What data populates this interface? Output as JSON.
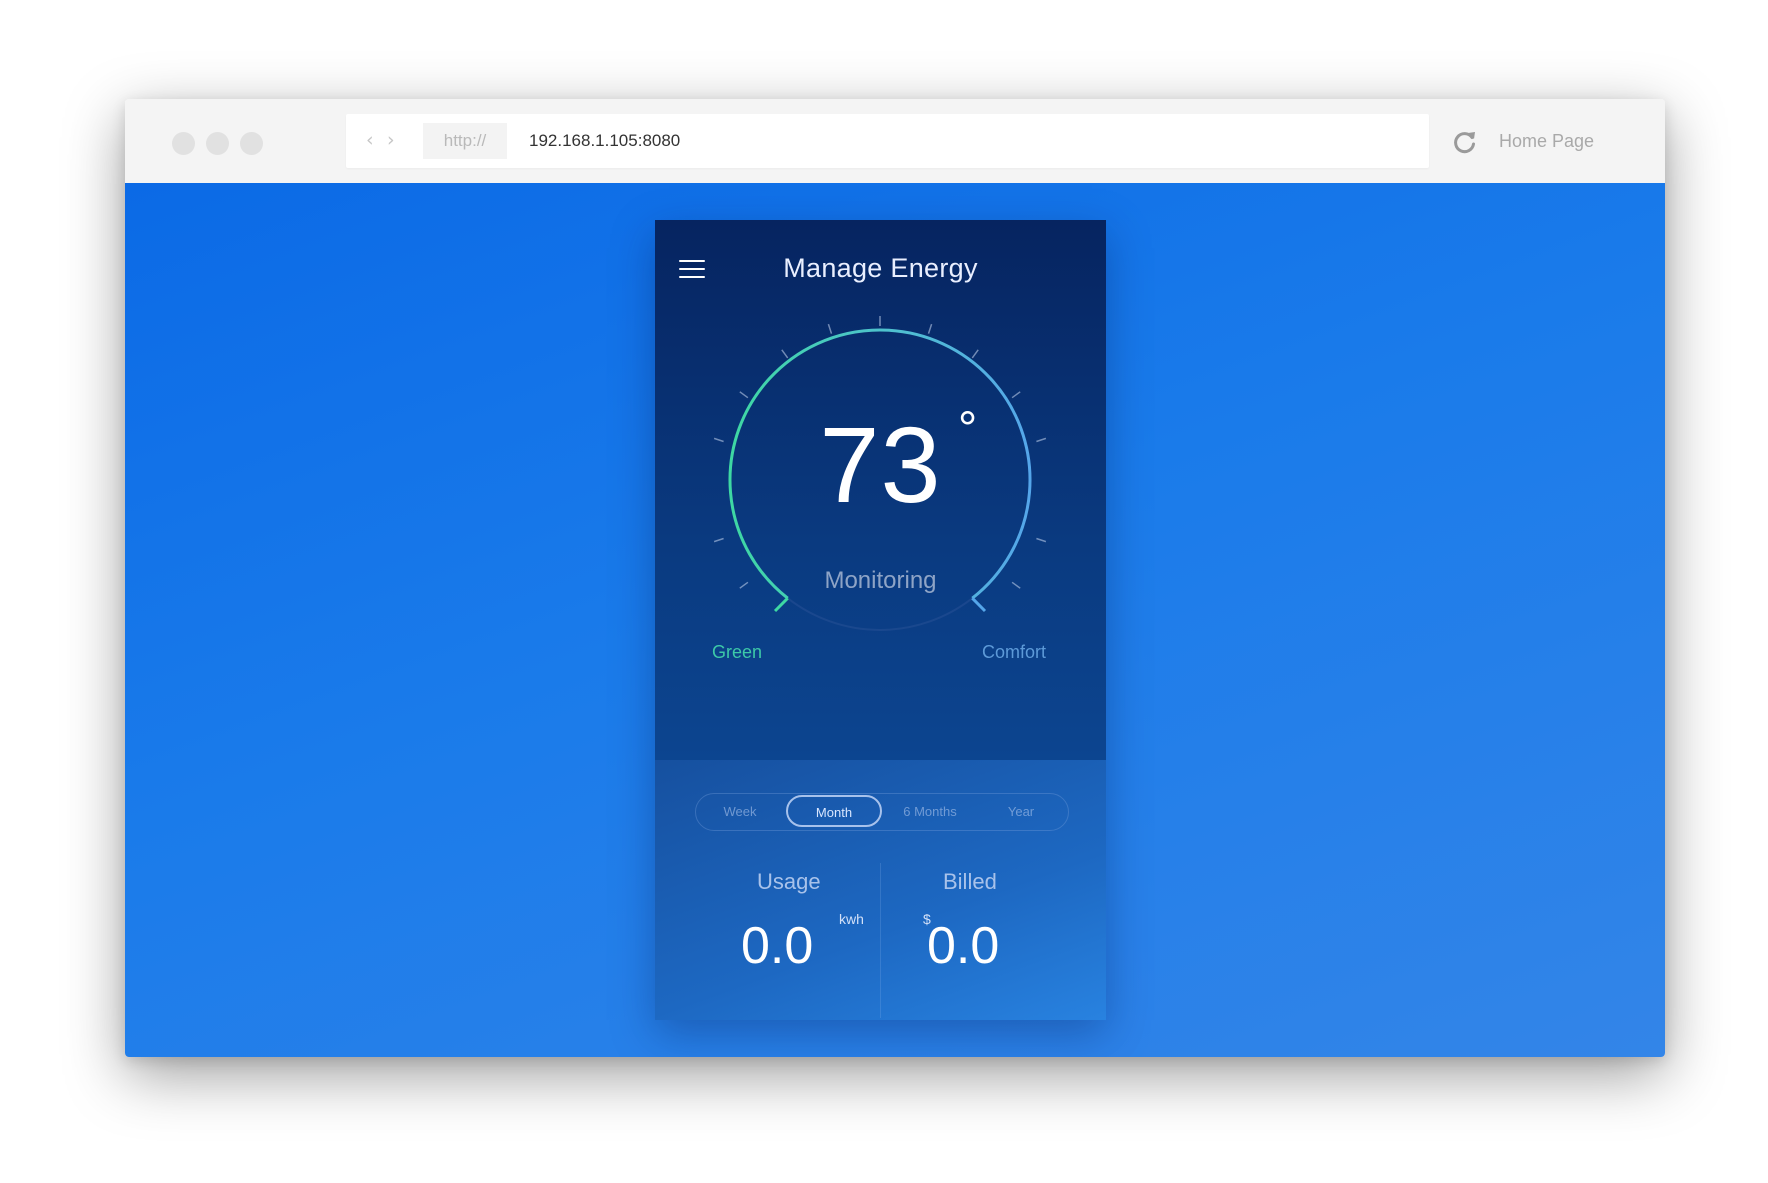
{
  "browser": {
    "scheme": "http://",
    "address": "192.168.1.105:8080",
    "home_label": "Home Page",
    "icons": {
      "back": "chevron-left-icon",
      "forward": "chevron-right-icon",
      "reload": "reload-icon"
    }
  },
  "app": {
    "title": "Manage Energy",
    "temperature": "73",
    "degree_symbol": "°",
    "status": "Monitoring",
    "gauge_left_label": "Green",
    "gauge_right_label": "Comfort",
    "periods": [
      "Week",
      "Month",
      "6 Months",
      "Year"
    ],
    "selected_period": "Month",
    "usage": {
      "label": "Usage",
      "value": "0.0",
      "unit": "kwh"
    },
    "billed": {
      "label": "Billed",
      "value": "0.0",
      "currency": "$"
    }
  },
  "colors": {
    "background_blue": "#1a7bea",
    "panel_navy": "#0a3a80",
    "gauge_green": "#3ed8a3",
    "gauge_blue": "#55a6ea"
  }
}
